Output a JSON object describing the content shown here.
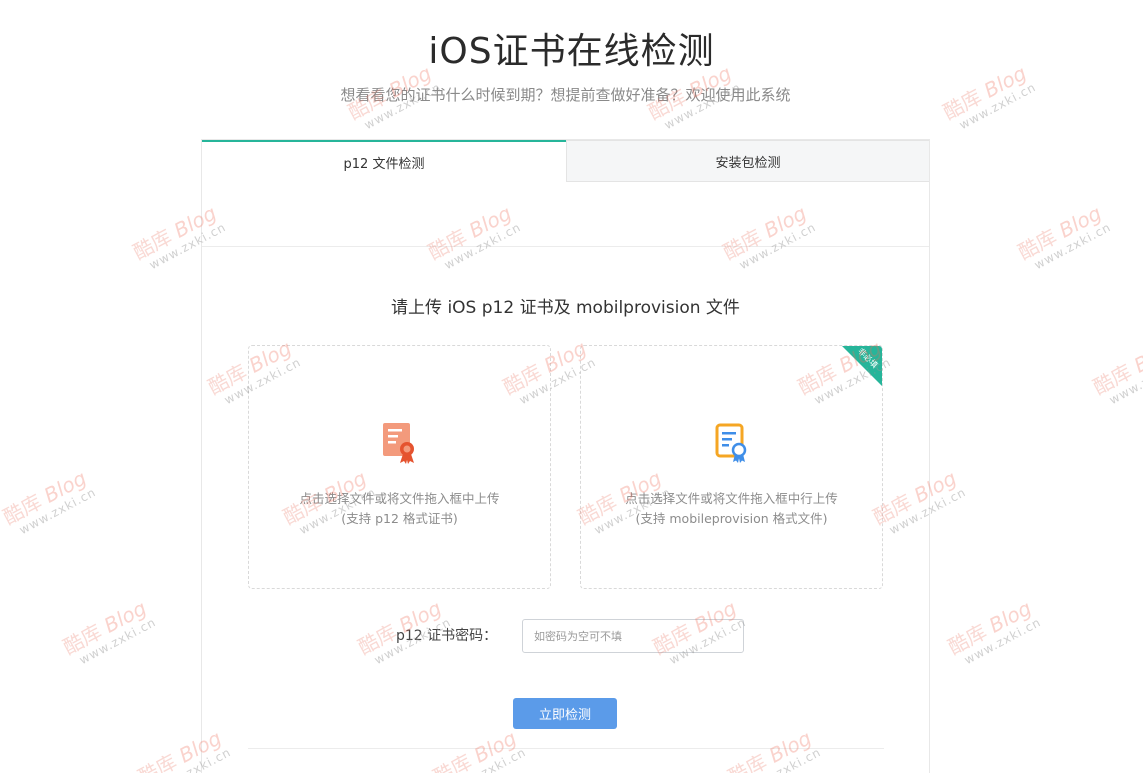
{
  "header": {
    "title": "iOS证书在线检测",
    "subtitle": "想看看您的证书什么时候到期？想提前查做好准备？欢迎使用此系统"
  },
  "tabs": [
    {
      "label": "p12 文件检测",
      "active": true
    },
    {
      "label": "安装包检测",
      "active": false
    }
  ],
  "upload": {
    "heading": "请上传 iOS p12 证书及 mobilprovision 文件",
    "p12_box": {
      "line1": "点击选择文件或将文件拖入框中上传",
      "line2": "(支持 p12 格式证书)",
      "icon": "certificate-icon"
    },
    "provision_box": {
      "line1": "点击选择文件或将文件拖入框中行上传",
      "line2": "(支持 mobileprovision 格式文件)",
      "icon": "document-badge-icon",
      "badge": "非必填"
    }
  },
  "password": {
    "label": "p12 证书密码：",
    "placeholder": "如密码为空可不填"
  },
  "submit_label": "立即检测",
  "watermark": {
    "brand": "酷库",
    "word": "Blog",
    "url": "www.zxki.cn"
  },
  "colors": {
    "accent": "#26b59a",
    "button": "#5b9be9",
    "cert_icon": "#f07a5a",
    "doc_icon": "#f5a623"
  }
}
